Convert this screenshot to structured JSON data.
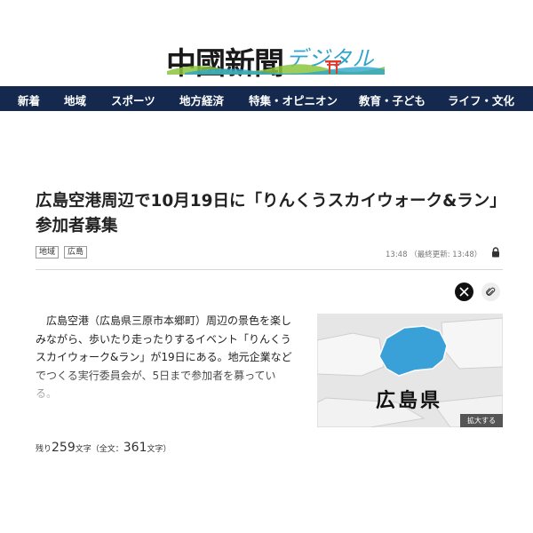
{
  "header": {
    "logo_main": "中國新聞",
    "logo_sub": "デジタル"
  },
  "nav": {
    "items": [
      "新着",
      "地域",
      "スポーツ",
      "地方経済",
      "特集・オピニオン",
      "教育・子ども",
      "ライフ・文化"
    ]
  },
  "article": {
    "title": "広島空港周辺で10月19日に「りんくうスカイウォーク&ラン」 参加者募集",
    "tags": [
      "地域",
      "広島"
    ],
    "timestamp": "13:48 （最終更新: 13:48）",
    "body": "　広島空港（広島県三原市本郷町）周辺の景色を楽しみながら、歩いたり走ったりするイベント「りんくうスカイウォーク&ラン」が19日にある。地元企業などでつくる実行委員会が、5日まで参加者を募っている。",
    "figure_label": "広島県",
    "expand_label": "拡大する",
    "remaining_prefix": "残り",
    "remaining_count": "259",
    "remaining_mid": "文字（全文：",
    "total_count": "361",
    "remaining_suffix": "文字）"
  },
  "colors": {
    "nav_bg": "#15294f",
    "map_highlight": "#3aa0d8",
    "logo_accent": "#2ea5c9"
  },
  "icons": [
    "torii-icon",
    "lock-icon",
    "x-share-icon",
    "paperclip-icon"
  ]
}
